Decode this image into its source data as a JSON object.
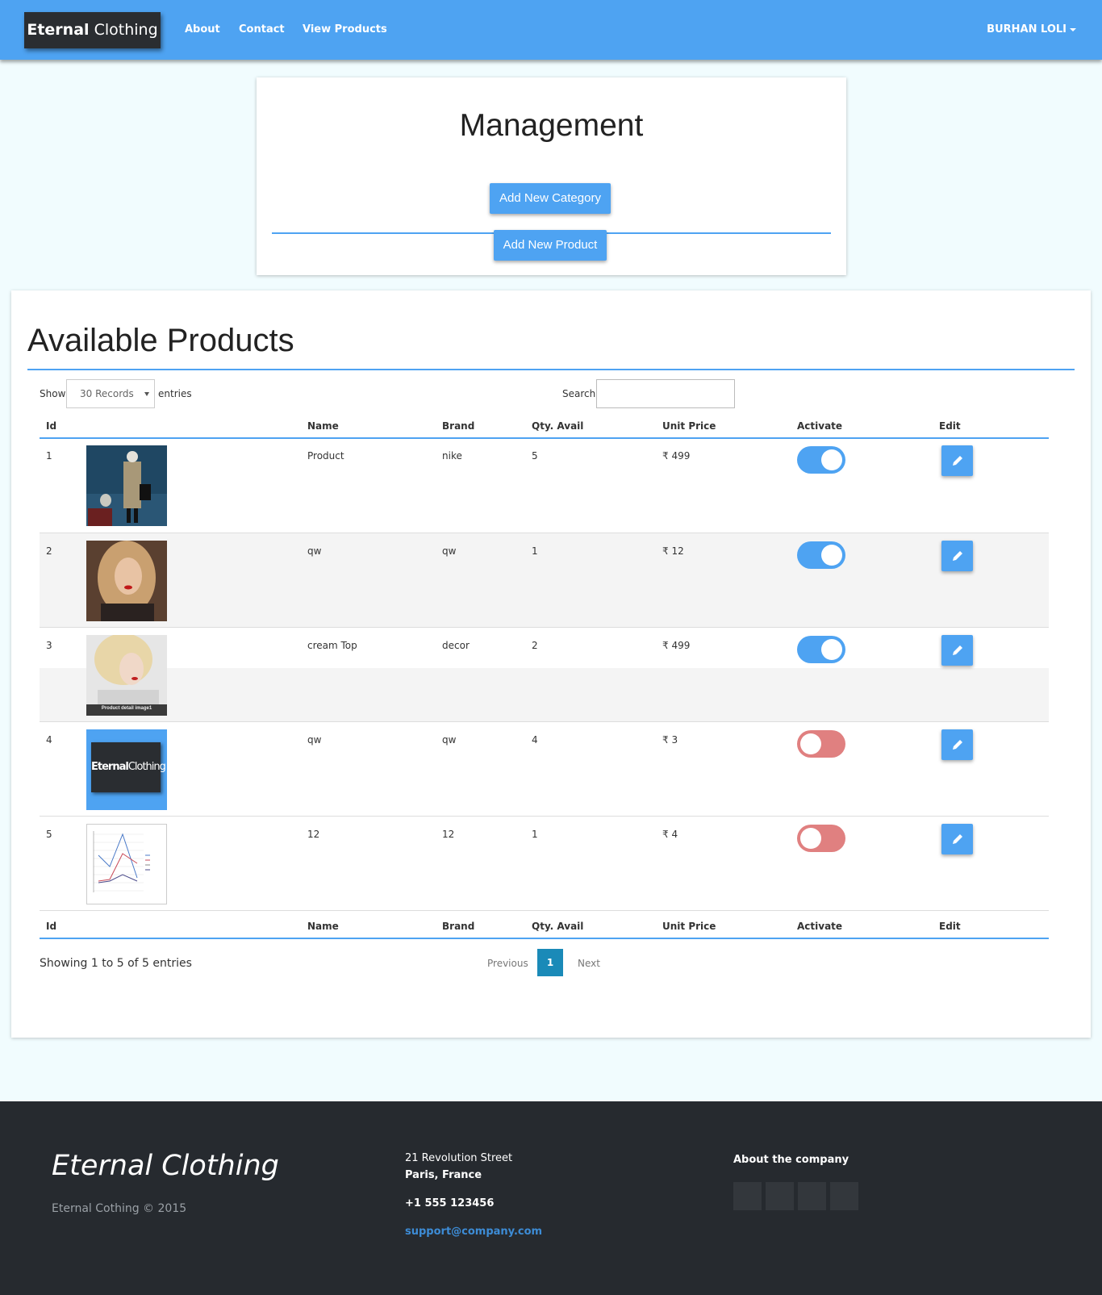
{
  "navbar": {
    "brand_bold": "Eternal",
    "brand_rest": "Clothing",
    "links": [
      "About",
      "Contact",
      "View Products"
    ],
    "user": "BURHAN LOLI"
  },
  "management": {
    "title": "Management",
    "add_category_label": "Add New Category",
    "add_product_label": "Add New Product"
  },
  "products": {
    "title": "Available Products",
    "show_label": "Show",
    "records_select": "30 Records",
    "entries_label": "entries",
    "search_label": "Search:",
    "search_value": "",
    "columns": [
      "Id",
      "Name",
      "Brand",
      "Qty. Avail",
      "Unit Price",
      "Activate",
      "Edit"
    ],
    "rows": [
      {
        "id": "1",
        "name": "Product",
        "brand": "nike",
        "qty": "5",
        "price": "₹ 499",
        "active": true
      },
      {
        "id": "2",
        "name": "qw",
        "brand": "qw",
        "qty": "1",
        "price": "₹ 12",
        "active": true
      },
      {
        "id": "3",
        "name": "cream Top",
        "brand": "decor",
        "qty": "2",
        "price": "₹ 499",
        "active": true
      },
      {
        "id": "4",
        "name": "qw",
        "brand": "qw",
        "qty": "4",
        "price": "₹ 3",
        "active": false
      },
      {
        "id": "5",
        "name": "12",
        "brand": "12",
        "qty": "1",
        "price": "₹ 4",
        "active": false
      }
    ],
    "thumb3_caption": "Product detail image1",
    "thumb4_brand_bold": "Eternal",
    "thumb4_brand_rest": "Clothing",
    "info": "Showing 1 to 5 of 5 entries",
    "pagination": {
      "previous": "Previous",
      "current": "1",
      "next": "Next"
    }
  },
  "footer": {
    "brand": "Eternal Clothing",
    "copyright": "Eternal Cothing © 2015",
    "address_line1": "21 Revolution Street",
    "address_line2": "Paris, France",
    "phone": "+1 555 123456",
    "email": "support@company.com",
    "about": "About the company"
  },
  "colors": {
    "accent": "#4ea3f2",
    "toggle_off": "#e08080",
    "footer_bg": "#262a2f",
    "page_bg": "#f1fcfe"
  }
}
